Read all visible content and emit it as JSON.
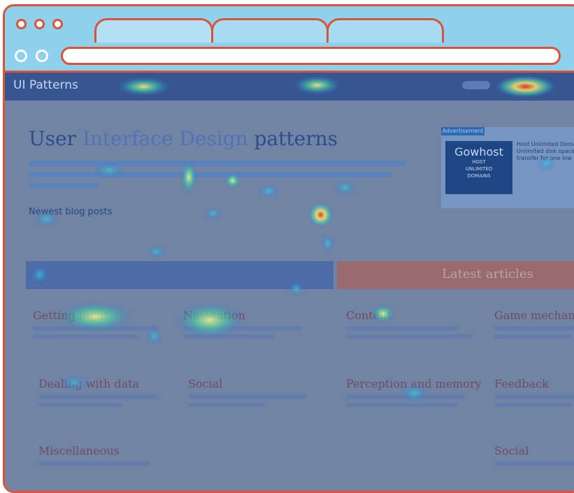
{
  "site": {
    "logo": "UI Patterns",
    "title_part1": "User ",
    "title_part2": "Interface Design",
    "title_part3": " patterns",
    "blog_link": "Newest blog posts",
    "section_banner": "Latest articles"
  },
  "ad": {
    "label": "Advertisement",
    "brand": "Gowhost",
    "tag1": "HOST",
    "tag2": "UNLIMITED",
    "tag3": "DOMAINS",
    "copy": "Host Unlimited Domains, Unlimited disk space, transfer for one low price"
  },
  "categories": [
    {
      "title": "Getting input"
    },
    {
      "title": "Navigation"
    },
    {
      "title": "Content"
    },
    {
      "title": "Game mechanics"
    },
    {
      "title": "Dealing with data"
    },
    {
      "title": "Social"
    },
    {
      "title": "Perception and memory"
    },
    {
      "title": "Feedback"
    },
    {
      "title": "Miscellaneous"
    },
    {
      "title": "Social"
    }
  ],
  "colors": {
    "frame": "#d9533a",
    "chrome": "#8fd0ec",
    "heat_hot": "#e8302a",
    "heat_warm": "#f5e96b",
    "heat_cool": "#2a6fd9"
  }
}
